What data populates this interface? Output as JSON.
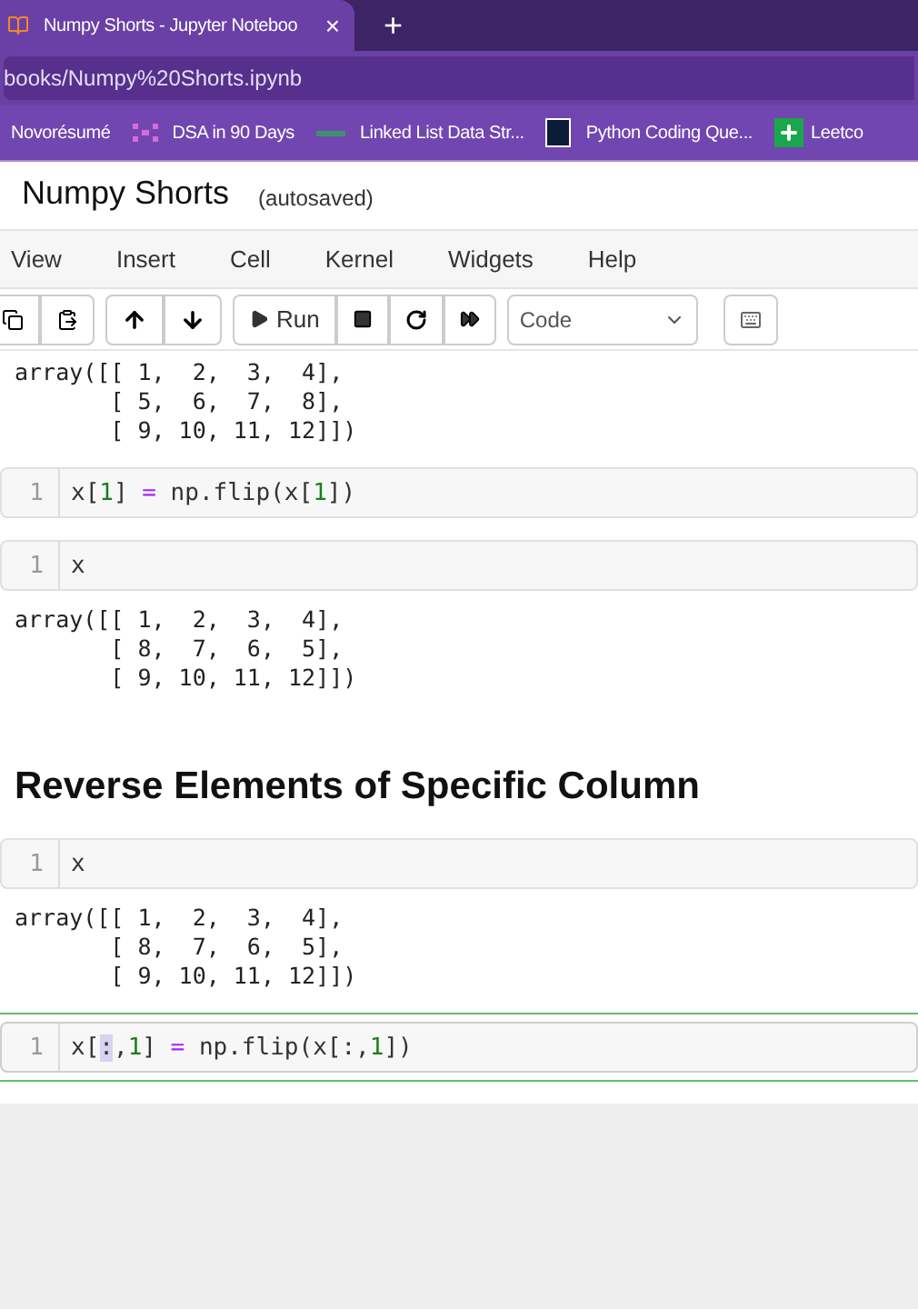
{
  "browser": {
    "tab": {
      "title": "Numpy Shorts - Jupyter Noteboo",
      "close": "×"
    },
    "new_tab": "+",
    "address": "books/Numpy%20Shorts.ipynb",
    "bookmarks": [
      {
        "label": "Novorésumé",
        "kind": "none"
      },
      {
        "label": "DSA in 90 Days",
        "kind": "dots"
      },
      {
        "label": "Linked List Data Str...",
        "kind": "dash"
      },
      {
        "label": "Python Coding Que...",
        "kind": "q"
      },
      {
        "label": "Leetco",
        "kind": "plus"
      }
    ]
  },
  "notebook": {
    "title": "Numpy Shorts",
    "status": "(autosaved)",
    "menu": [
      "View",
      "Insert",
      "Cell",
      "Kernel",
      "Widgets",
      "Help"
    ],
    "toolbar": {
      "run": "Run",
      "cell_type": "Code"
    },
    "cells": [
      {
        "kind": "output",
        "text": "array([[ 1,  2,  3,  4],\n       [ 5,  6,  7,  8],\n       [ 9, 10, 11, 12]])"
      },
      {
        "kind": "code",
        "selected": false,
        "line": "1",
        "tokens": [
          {
            "text": "x[",
            "kind": "plain"
          },
          {
            "text": "1",
            "kind": "number"
          },
          {
            "text": "] ",
            "kind": "plain"
          },
          {
            "text": "=",
            "kind": "operator"
          },
          {
            "text": " np.flip(x[",
            "kind": "plain"
          },
          {
            "text": "1",
            "kind": "number"
          },
          {
            "text": "])",
            "kind": "plain"
          }
        ]
      },
      {
        "kind": "code",
        "selected": false,
        "line": "1",
        "tokens": [
          {
            "text": "x",
            "kind": "plain"
          }
        ]
      },
      {
        "kind": "output",
        "text": "array([[ 1,  2,  3,  4],\n       [ 8,  7,  6,  5],\n       [ 9, 10, 11, 12]])"
      },
      {
        "kind": "heading",
        "text": "Reverse Elements of Specific Column"
      },
      {
        "kind": "code",
        "selected": false,
        "line": "1",
        "tokens": [
          {
            "text": "x",
            "kind": "plain"
          }
        ]
      },
      {
        "kind": "output",
        "text": "array([[ 1,  2,  3,  4],\n       [ 8,  7,  6,  5],\n       [ 9, 10, 11, 12]])"
      },
      {
        "kind": "code",
        "selected": true,
        "line": "1",
        "tokens": [
          {
            "text": "x[",
            "kind": "plain"
          },
          {
            "text": ":",
            "kind": "highlight"
          },
          {
            "text": ",",
            "kind": "plain"
          },
          {
            "text": "1",
            "kind": "number"
          },
          {
            "text": "] ",
            "kind": "plain"
          },
          {
            "text": "=",
            "kind": "operator"
          },
          {
            "text": " np.flip(x[:,",
            "kind": "plain"
          },
          {
            "text": "1",
            "kind": "number"
          },
          {
            "text": "])",
            "kind": "plain"
          }
        ]
      }
    ]
  }
}
